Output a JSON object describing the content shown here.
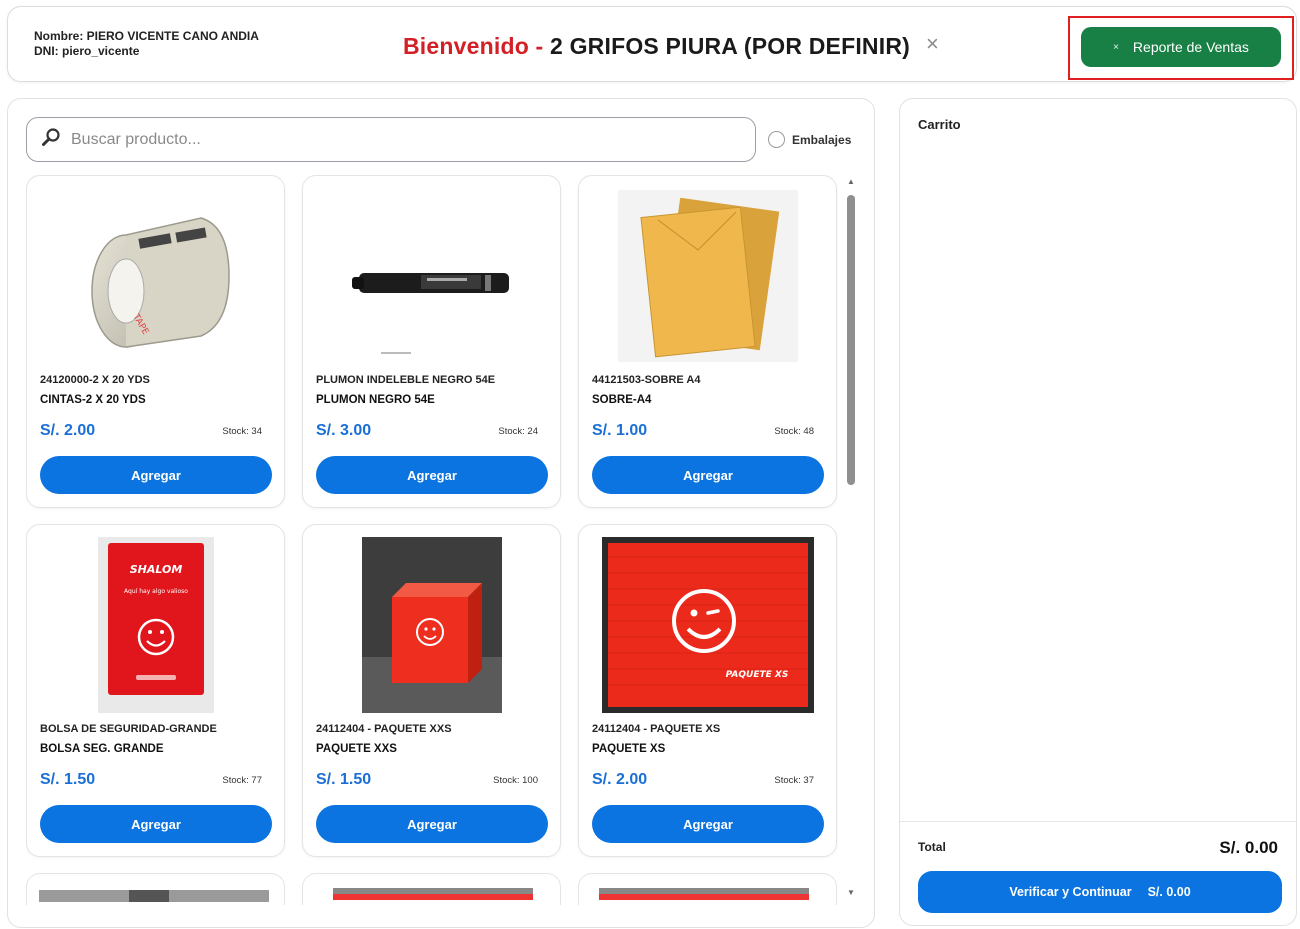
{
  "header": {
    "user_name_line": "Nombre: PIERO VICENTE CANO ANDIA",
    "user_dni_line": "DNI: piero_vicente",
    "welcome_prefix": "Bienvenido -",
    "store_name": "2 GRIFOS PIURA (POR DEFINIR)",
    "close_symbol": "×",
    "report_button_icon": "×",
    "report_button_label": "Reporte de Ventas"
  },
  "search": {
    "placeholder": "Buscar producto...",
    "value": ""
  },
  "filter": {
    "embalajes_label": "Embalajes",
    "embalajes_checked": false
  },
  "products": [
    {
      "code": "24120000-2 X 20 YDS",
      "name": "CINTAS-2 X 20 YDS",
      "price": "S/. 2.00",
      "stock": "Stock: 34",
      "add_label": "Agregar",
      "image": "tape-icon"
    },
    {
      "code": "PLUMON INDELEBLE NEGRO 54E",
      "name": "PLUMON NEGRO 54E",
      "price": "S/. 3.00",
      "stock": "Stock: 24",
      "add_label": "Agregar",
      "image": "marker-icon"
    },
    {
      "code": "44121503-SOBRE A4",
      "name": "SOBRE-A4",
      "price": "S/. 1.00",
      "stock": "Stock: 48",
      "add_label": "Agregar",
      "image": "envelope-icon"
    },
    {
      "code": "BOLSA DE SEGURIDAD-GRANDE",
      "name": "BOLSA SEG. GRANDE",
      "price": "S/. 1.50",
      "stock": "Stock: 77",
      "add_label": "Agregar",
      "image": "security-bag-icon"
    },
    {
      "code": "24112404 - PAQUETE XXS",
      "name": "PAQUETE XXS",
      "price": "S/. 1.50",
      "stock": "Stock: 100",
      "add_label": "Agregar",
      "image": "box-xxs-icon"
    },
    {
      "code": "24112404 - PAQUETE XS",
      "name": "PAQUETE XS",
      "price": "S/. 2.00",
      "stock": "Stock: 37",
      "add_label": "Agregar",
      "image": "box-xs-icon"
    }
  ],
  "product_images": {
    "bag_brand": "SHALOM",
    "bag_text": "Aquí hay algo valioso",
    "box_xs_label": "PAQUETE XS"
  },
  "cart": {
    "title": "Carrito",
    "total_label": "Total",
    "total_value": "S/. 0.00",
    "verify_label": "Verificar y Continuar",
    "verify_amount": "S/. 0.00"
  },
  "colors": {
    "accent_blue": "#0b74e0",
    "report_green": "#198045",
    "welcome_red": "#d32027",
    "highlight_red": "#e02020"
  }
}
